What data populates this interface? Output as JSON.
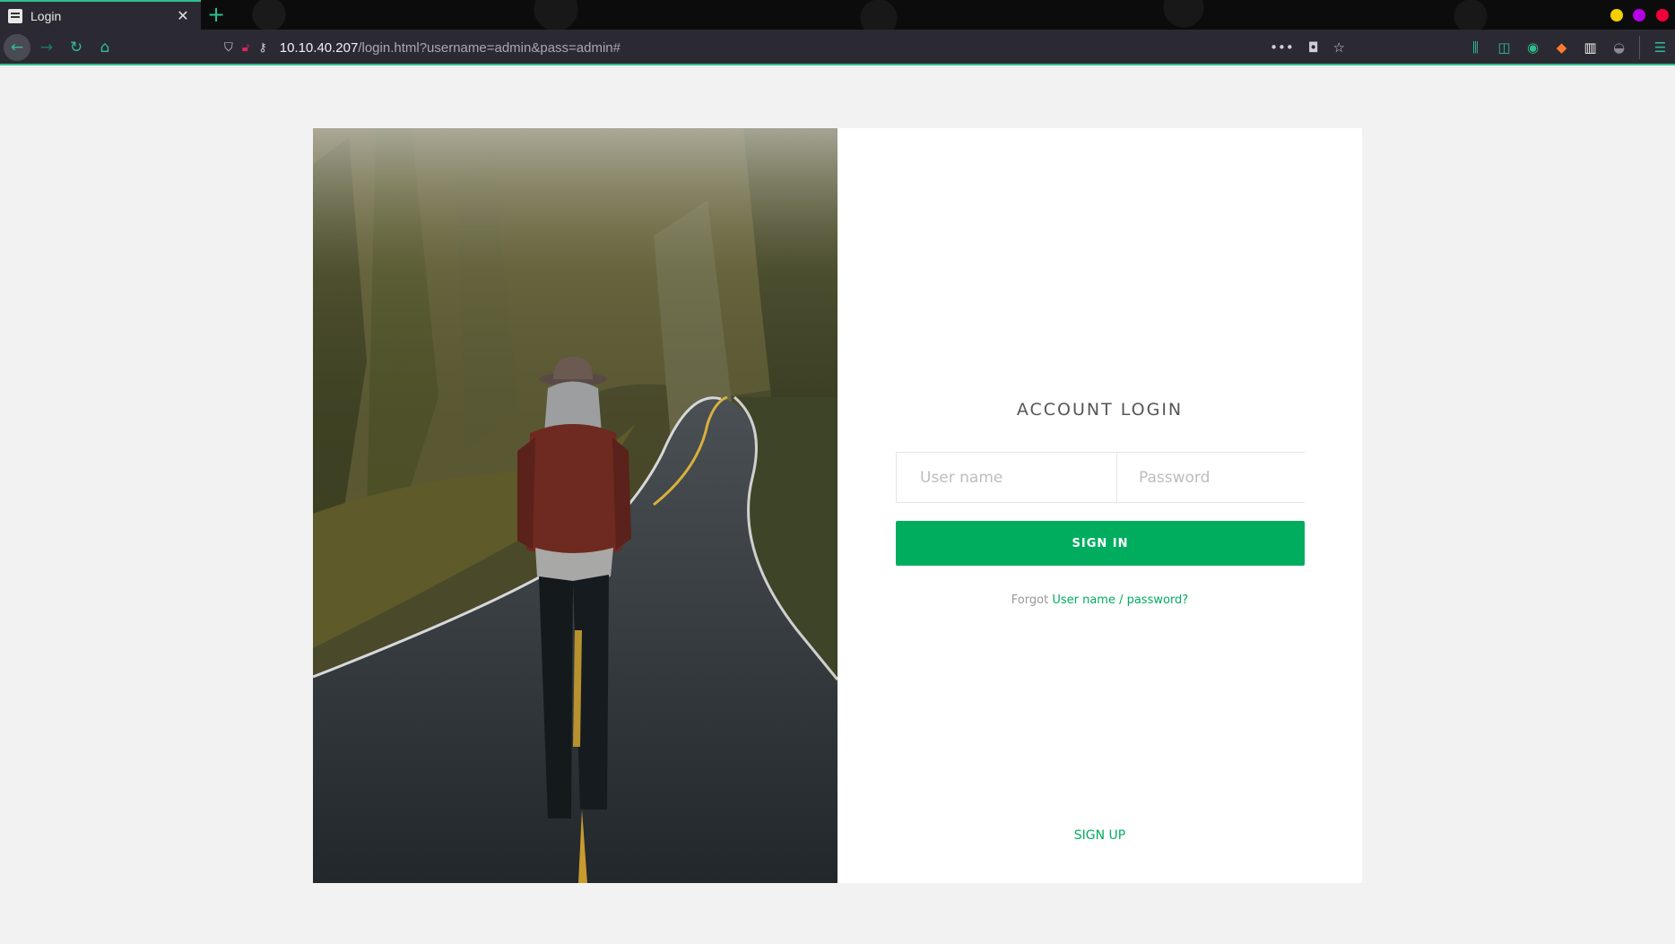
{
  "browser": {
    "tab_title": "Login",
    "tab_close_glyph": "✕",
    "new_tab_glyph": "+",
    "url_host": "10.10.40.207",
    "url_path": "/login.html?username=admin&pass=admin#",
    "accent_color": "#2fbf8f"
  },
  "login": {
    "title": "ACCOUNT LOGIN",
    "username_placeholder": "User name",
    "password_placeholder": "Password",
    "signin_label": "SIGN IN",
    "forgot_prefix": "Forgot",
    "forgot_link": "User name / password?",
    "signup_label": "SIGN UP",
    "brand_color": "#00ad5f"
  }
}
